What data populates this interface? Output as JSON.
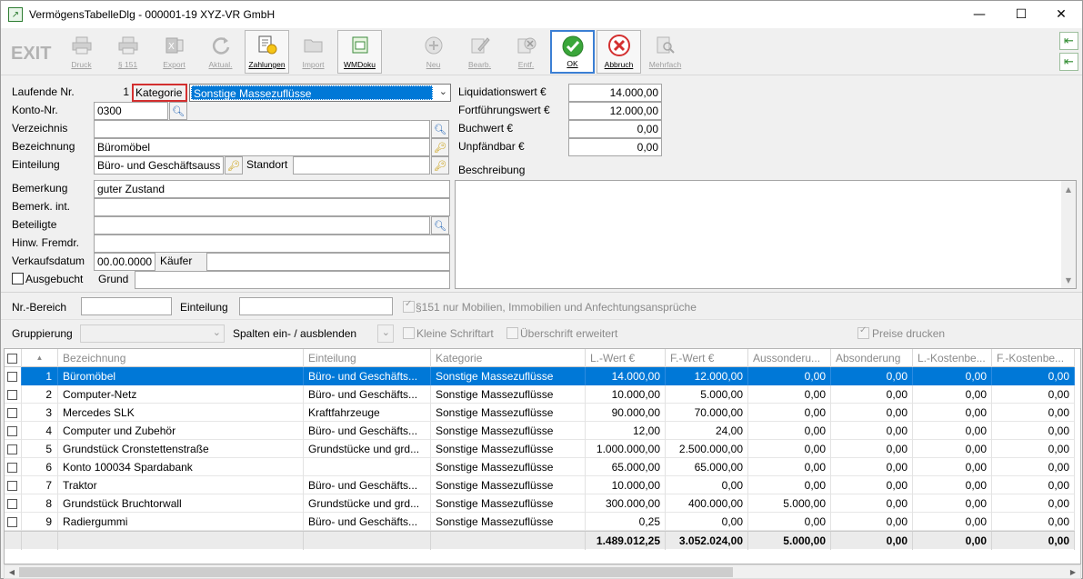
{
  "window": {
    "title": "VermögensTabelleDlg - 000001-19 XYZ-VR GmbH",
    "app_icon": "chart-window-icon",
    "accent": "#0078d7"
  },
  "toolbar": [
    {
      "id": "exit",
      "label": "EXIT",
      "enabled": false,
      "icon": "exit-text"
    },
    {
      "id": "druck",
      "label": "Druck",
      "enabled": false,
      "icon": "printer-icon"
    },
    {
      "id": "p151",
      "label": "§ 151",
      "enabled": false,
      "icon": "printer-icon"
    },
    {
      "id": "export",
      "label": "Export",
      "enabled": false,
      "icon": "excel-icon"
    },
    {
      "id": "aktual",
      "label": "Aktual.",
      "enabled": false,
      "icon": "refresh-icon"
    },
    {
      "id": "zahlungen",
      "label": "Zahlungen",
      "enabled": true,
      "icon": "payments-icon"
    },
    {
      "id": "import",
      "label": "Import",
      "enabled": false,
      "icon": "folder-icon"
    },
    {
      "id": "wmdoku",
      "label": "WMDoku",
      "enabled": true,
      "icon": "document-folder-icon"
    },
    {
      "id": "neu",
      "label": "Neu",
      "enabled": false,
      "icon": "plus-icon"
    },
    {
      "id": "bearb",
      "label": "Bearb.",
      "enabled": false,
      "icon": "edit-icon"
    },
    {
      "id": "entf",
      "label": "Entf.",
      "enabled": false,
      "icon": "delete-icon"
    },
    {
      "id": "ok",
      "label": "OK",
      "enabled": true,
      "icon": "checkmark-icon"
    },
    {
      "id": "abbruch",
      "label": "Abbruch",
      "enabled": true,
      "icon": "cancel-icon"
    },
    {
      "id": "mehrfach",
      "label": "Mehrfach",
      "enabled": false,
      "icon": "magnifier-document-icon"
    }
  ],
  "side_buttons": [
    {
      "icon": "arrow-left-icon"
    },
    {
      "icon": "arrow-left-icon"
    }
  ],
  "form": {
    "laufende_nr": {
      "label": "Laufende Nr.",
      "value": "1"
    },
    "kategorie": {
      "label": "Kategorie",
      "value": "Sonstige Massezuflüsse"
    },
    "konto_nr": {
      "label": "Konto-Nr.",
      "value": "0300"
    },
    "verzeichnis": {
      "label": "Verzeichnis",
      "value": ""
    },
    "bezeichnung": {
      "label": "Bezeichnung",
      "value": "Büromöbel"
    },
    "einteilung": {
      "label": "Einteilung",
      "value": "Büro- und Geschäftsauss"
    },
    "standort": {
      "label": "Standort",
      "value": ""
    },
    "bemerkung": {
      "label": "Bemerkung",
      "value": "guter Zustand"
    },
    "bemerk_int": {
      "label": "Bemerk. int.",
      "value": ""
    },
    "beteiligte": {
      "label": "Beteiligte",
      "value": ""
    },
    "hinw_fremdr": {
      "label": "Hinw. Fremdr.",
      "value": ""
    },
    "verkaufsdatum": {
      "label": "Verkaufsdatum",
      "value": "00.00.0000"
    },
    "kaeufer": {
      "label": "Käufer",
      "value": ""
    },
    "ausgebucht": {
      "label": "Ausgebucht",
      "checked": false
    },
    "grund": {
      "label": "Grund",
      "value": ""
    },
    "liquidationswert": {
      "label": "Liquidationswert €",
      "value": "14.000,00"
    },
    "fortfuehrungswert": {
      "label": "Fortführungswert €",
      "value": "12.000,00"
    },
    "buchwert": {
      "label": "Buchwert €",
      "value": "0,00"
    },
    "unpfaendbar": {
      "label": "Unpfändbar €",
      "value": "0,00"
    },
    "beschreibung": {
      "label": "Beschreibung",
      "value": ""
    }
  },
  "filter": {
    "nr_bereich": {
      "label": "Nr.-Bereich",
      "value": ""
    },
    "einteilung": {
      "label": "Einteilung",
      "value": ""
    },
    "p151_check": {
      "label": "§151 nur Mobilien, Immobilien und Anfechtungsansprüche",
      "checked": true
    },
    "gruppierung": {
      "label": "Gruppierung",
      "value": ""
    },
    "spalten": {
      "label": "Spalten ein- / ausblenden"
    },
    "kleine_schrift": {
      "label": "Kleine Schriftart",
      "checked": false
    },
    "ueberschrift": {
      "label": "Überschrift erweitert",
      "checked": false
    },
    "preise_drucken": {
      "label": "Preise drucken",
      "checked": true
    }
  },
  "table": {
    "columns": [
      "",
      "",
      "Bezeichnung",
      "Einteilung",
      "Kategorie",
      "L.-Wert €",
      "F.-Wert €",
      "Aussonderu...",
      "Absonderung",
      "L.-Kostenbe...",
      "F.-Kostenbe..."
    ],
    "sort_indicator": "▲",
    "rows": [
      {
        "nr": "1",
        "bezeichnung": "Büromöbel",
        "einteilung": "Büro- und Geschäfts...",
        "kategorie": "Sonstige Massezuflüsse",
        "l_wert": "14.000,00",
        "f_wert": "12.000,00",
        "aussonderung": "0,00",
        "absonderung": "0,00",
        "l_kosten": "0,00",
        "f_kosten": "0,00",
        "selected": true
      },
      {
        "nr": "2",
        "bezeichnung": "Computer-Netz",
        "einteilung": "Büro- und Geschäfts...",
        "kategorie": "Sonstige Massezuflüsse",
        "l_wert": "10.000,00",
        "f_wert": "5.000,00",
        "aussonderung": "0,00",
        "absonderung": "0,00",
        "l_kosten": "0,00",
        "f_kosten": "0,00"
      },
      {
        "nr": "3",
        "bezeichnung": "Mercedes SLK",
        "einteilung": "Kraftfahrzeuge",
        "kategorie": "Sonstige Massezuflüsse",
        "l_wert": "90.000,00",
        "f_wert": "70.000,00",
        "aussonderung": "0,00",
        "absonderung": "0,00",
        "l_kosten": "0,00",
        "f_kosten": "0,00"
      },
      {
        "nr": "4",
        "bezeichnung": "Computer und Zubehör",
        "einteilung": "Büro- und Geschäfts...",
        "kategorie": "Sonstige Massezuflüsse",
        "l_wert": "12,00",
        "f_wert": "24,00",
        "aussonderung": "0,00",
        "absonderung": "0,00",
        "l_kosten": "0,00",
        "f_kosten": "0,00"
      },
      {
        "nr": "5",
        "bezeichnung": "Grundstück Cronstettenstraße",
        "einteilung": "Grundstücke und grd...",
        "kategorie": "Sonstige Massezuflüsse",
        "l_wert": "1.000.000,00",
        "f_wert": "2.500.000,00",
        "aussonderung": "0,00",
        "absonderung": "0,00",
        "l_kosten": "0,00",
        "f_kosten": "0,00"
      },
      {
        "nr": "6",
        "bezeichnung": "Konto 100034 Spardabank",
        "einteilung": "",
        "kategorie": "Sonstige Massezuflüsse",
        "l_wert": "65.000,00",
        "f_wert": "65.000,00",
        "aussonderung": "0,00",
        "absonderung": "0,00",
        "l_kosten": "0,00",
        "f_kosten": "0,00"
      },
      {
        "nr": "7",
        "bezeichnung": "Traktor",
        "einteilung": "Büro- und Geschäfts...",
        "kategorie": "Sonstige Massezuflüsse",
        "l_wert": "10.000,00",
        "f_wert": "0,00",
        "aussonderung": "0,00",
        "absonderung": "0,00",
        "l_kosten": "0,00",
        "f_kosten": "0,00"
      },
      {
        "nr": "8",
        "bezeichnung": "Grundstück Bruchtorwall",
        "einteilung": "Grundstücke und grd...",
        "kategorie": "Sonstige Massezuflüsse",
        "l_wert": "300.000,00",
        "f_wert": "400.000,00",
        "aussonderung": "5.000,00",
        "absonderung": "0,00",
        "l_kosten": "0,00",
        "f_kosten": "0,00"
      },
      {
        "nr": "9",
        "bezeichnung": "Radiergummi",
        "einteilung": "Büro- und Geschäfts...",
        "kategorie": "Sonstige Massezuflüsse",
        "l_wert": "0,25",
        "f_wert": "0,00",
        "aussonderung": "0,00",
        "absonderung": "0,00",
        "l_kosten": "0,00",
        "f_kosten": "0,00"
      }
    ],
    "totals": {
      "l_wert": "1.489.012,25",
      "f_wert": "3.052.024,00",
      "aussonderung": "5.000,00",
      "absonderung": "0,00",
      "l_kosten": "0,00",
      "f_kosten": "0,00"
    }
  }
}
